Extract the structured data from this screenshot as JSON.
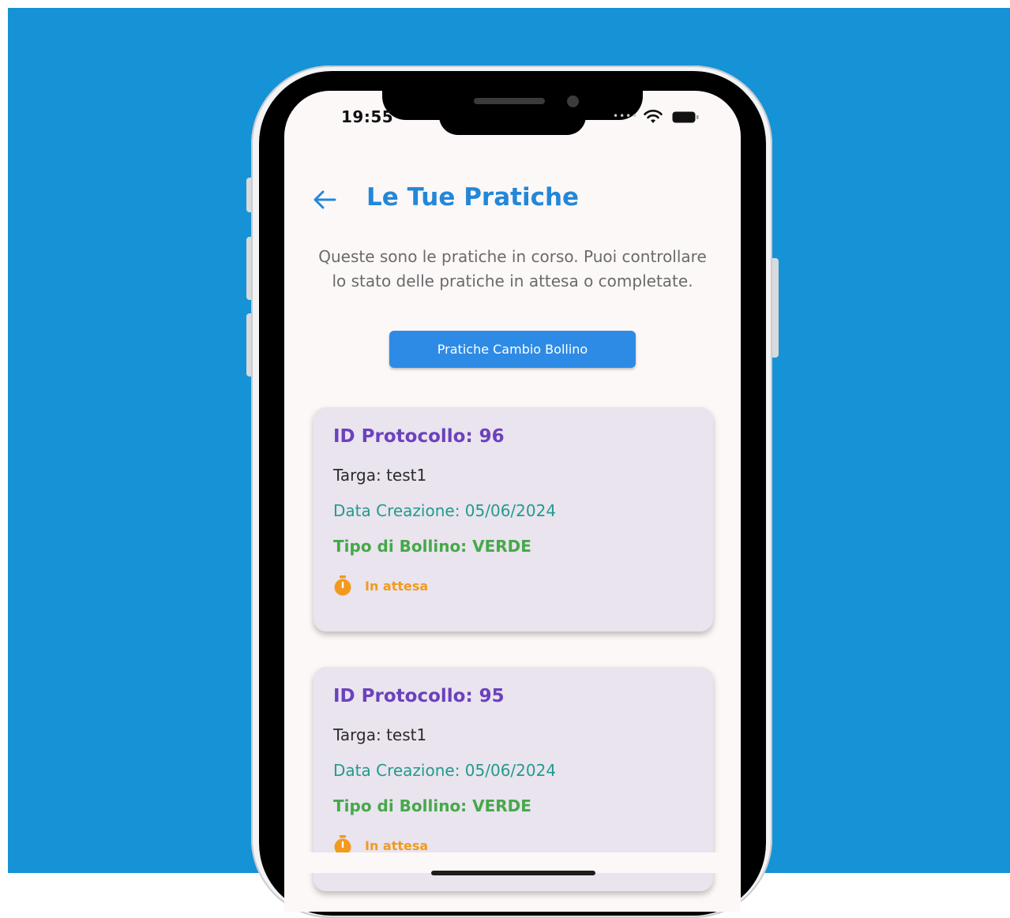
{
  "status_bar": {
    "time": "19:55",
    "signal_icon": "signal-dots-icon",
    "wifi_icon": "wifi-icon",
    "battery_icon": "battery-icon"
  },
  "header": {
    "back_icon": "arrow-left-icon",
    "title": "Le Tue Pratiche"
  },
  "intro_text": "Queste sono le pratiche in corso. Puoi controllare lo stato delle pratiche in attesa o completate.",
  "primary_button": {
    "label": "Pratiche Cambio Bollino"
  },
  "cards": [
    {
      "id_line": "ID Protocollo: 96",
      "targa_line": "Targa: test1",
      "data_line": "Data Creazione: 05/06/2024",
      "tipo_line": "Tipo di Bollino: VERDE",
      "status_icon": "timer-icon",
      "status": "In attesa"
    },
    {
      "id_line": "ID Protocollo: 95",
      "targa_line": "Targa: test1",
      "data_line": "Data Creazione: 05/06/2024",
      "tipo_line": "Tipo di Bollino: VERDE",
      "status_icon": "timer-icon",
      "status": "In attesa"
    }
  ],
  "colors": {
    "background": "#1692d6",
    "accent": "#2387d8",
    "button": "#2d8be6",
    "card": "#e9e4ee",
    "id": "#6c41bd",
    "date": "#239a8e",
    "bollino": "#46a84a",
    "pending": "#f29a1f"
  }
}
